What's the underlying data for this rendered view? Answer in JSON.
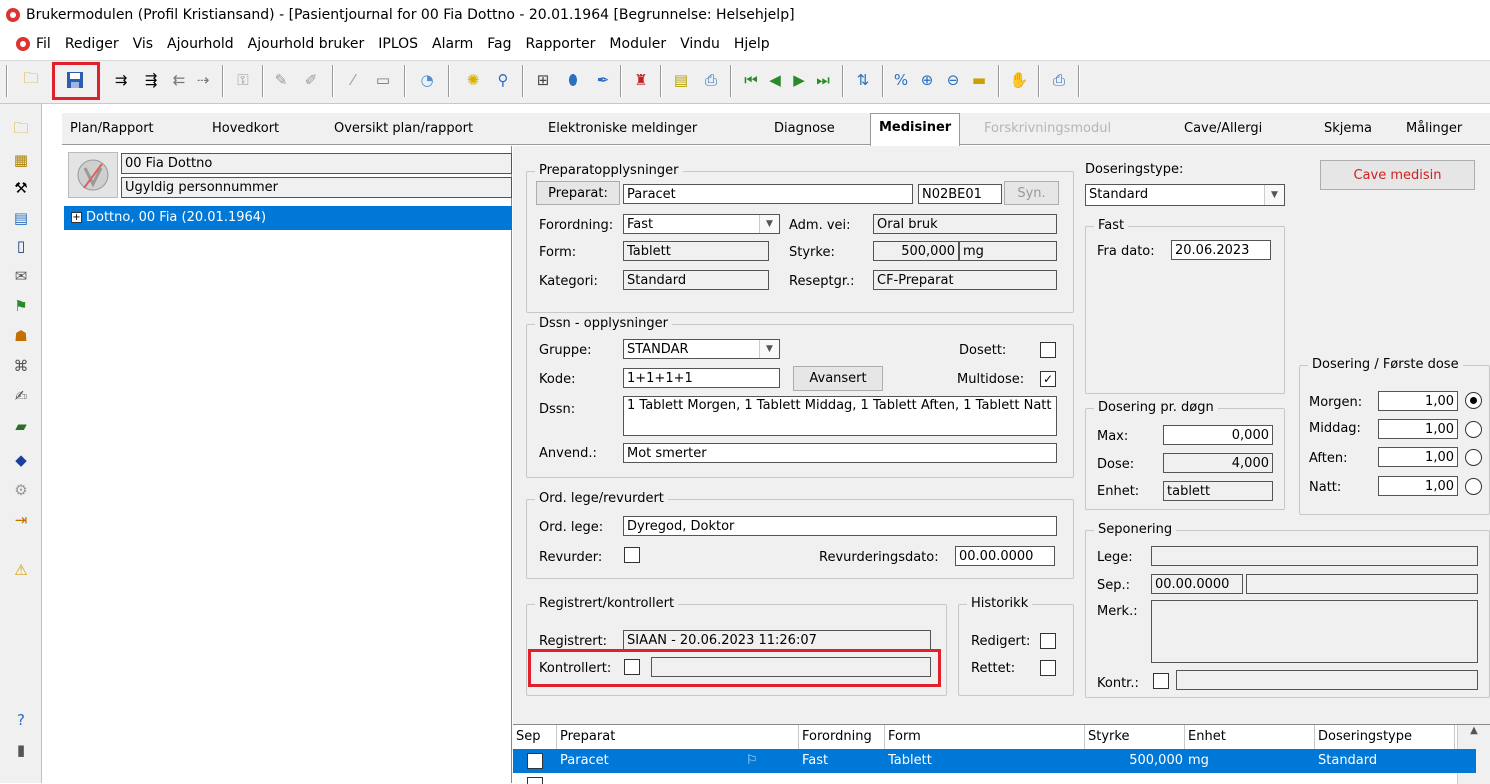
{
  "window": {
    "title": "Brukermodulen (Profil Kristiansand) - [Pasientjournal for 00 Fia Dottno - 20.01.1964    [Begrunnelse: Helsehjelp]"
  },
  "menu": [
    "Fil",
    "Rediger",
    "Vis",
    "Ajourhold",
    "Ajourhold bruker",
    "IPLOS",
    "Alarm",
    "Fag",
    "Rapporter",
    "Moduler",
    "Vindu",
    "Hjelp"
  ],
  "tabs": {
    "plan": "Plan/Rapport",
    "hovedkort": "Hovedkort",
    "oversikt": "Oversikt plan/rapport",
    "elektroniske": "Elektroniske meldinger",
    "diagnose": "Diagnose",
    "medisiner": "Medisiner",
    "forskrivning": "Forskrivningsmodul",
    "cave": "Cave/Allergi",
    "skjema": "Skjema",
    "malinger": "Målinger"
  },
  "patient": {
    "name": "00 Fia Dottno",
    "id_status": "Ugyldig personnummer",
    "tree_item": "Dottno, 00 Fia (20.01.1964)",
    "tree_expander": "+"
  },
  "prep": {
    "group_title": "Preparatopplysninger",
    "preparat_btn": "Preparat:",
    "preparat": "Paracet",
    "atc": "N02BE01",
    "syn_btn": "Syn.",
    "forordning_lbl": "Forordning:",
    "forordning": "Fast",
    "adm_lbl": "Adm. vei:",
    "adm": "Oral bruk",
    "form_lbl": "Form:",
    "form": "Tablett",
    "styrke_lbl": "Styrke:",
    "styrke": "500,000",
    "styrke_unit": "mg",
    "kategori_lbl": "Kategori:",
    "kategori": "Standard",
    "reseptgr_lbl": "Reseptgr.:",
    "reseptgr": "CF-Preparat"
  },
  "dssn": {
    "group_title": "Dssn - opplysninger",
    "gruppe_lbl": "Gruppe:",
    "gruppe": "STANDAR",
    "dosett_lbl": "Dosett:",
    "kode_lbl": "Kode:",
    "kode": "1+1+1+1",
    "avansert_btn": "Avansert",
    "multidose_lbl": "Multidose:",
    "multidose_check": "✓",
    "dssn_lbl": "Dssn:",
    "dssn_text": "1 Tablett Morgen, 1 Tablett Middag, 1 Tablett Aften, 1 Tablett Natt",
    "anvend_lbl": "Anvend.:",
    "anvend": "Mot smerter"
  },
  "lege": {
    "group_title": "Ord. lege/revurdert",
    "ord_lbl": "Ord. lege:",
    "ord": "Dyregod, Doktor",
    "revurder_lbl": "Revurder:",
    "revdato_lbl": "Revurderingsdato:",
    "revdato": "00.00.0000"
  },
  "reg": {
    "group_title": "Registrert/kontrollert",
    "registrert_lbl": "Registrert:",
    "registrert": "SIAAN - 20.06.2023 11:26:07",
    "kontrollert_lbl": "Kontrollert:",
    "kontrollert": ""
  },
  "hist": {
    "group_title": "Historikk",
    "redigert_lbl": "Redigert:",
    "rettet_lbl": "Rettet:"
  },
  "dos": {
    "type_lbl": "Doseringstype:",
    "type": "Standard",
    "cave_btn": "Cave medisin",
    "fast_title": "Fast",
    "fra_lbl": "Fra dato:",
    "fra": "20.06.2023",
    "first_title": "Dosering / Første dose",
    "morgen_lbl": "Morgen:",
    "morgen": "1,00",
    "middag_lbl": "Middag:",
    "middag": "1,00",
    "aften_lbl": "Aften:",
    "aften": "1,00",
    "natt_lbl": "Natt:",
    "natt": "1,00",
    "dogn_title": "Dosering pr. døgn",
    "max_lbl": "Max:",
    "max": "0,000",
    "dose_lbl": "Dose:",
    "dose": "4,000",
    "enhet_lbl": "Enhet:",
    "enhet": "tablett"
  },
  "sep": {
    "group_title": "Seponering",
    "lege_lbl": "Lege:",
    "lege": "",
    "sep_lbl": "Sep.:",
    "sep": "00.00.0000",
    "merk_lbl": "Merk.:",
    "kontr_lbl": "Kontr.:"
  },
  "grid": {
    "headers": [
      "Sep",
      "Preparat",
      "Forordning",
      "Form",
      "Styrke",
      "Enhet",
      "Doseringstype"
    ],
    "row": {
      "preparat": "Paracet",
      "forordning": "Fast",
      "form": "Tablett",
      "styrke": "500,000",
      "enhet": "mg",
      "type": "Standard"
    }
  },
  "colors": {
    "selection": "#0078d7",
    "highlight": "#e0202a",
    "cave_text": "#d02020"
  }
}
